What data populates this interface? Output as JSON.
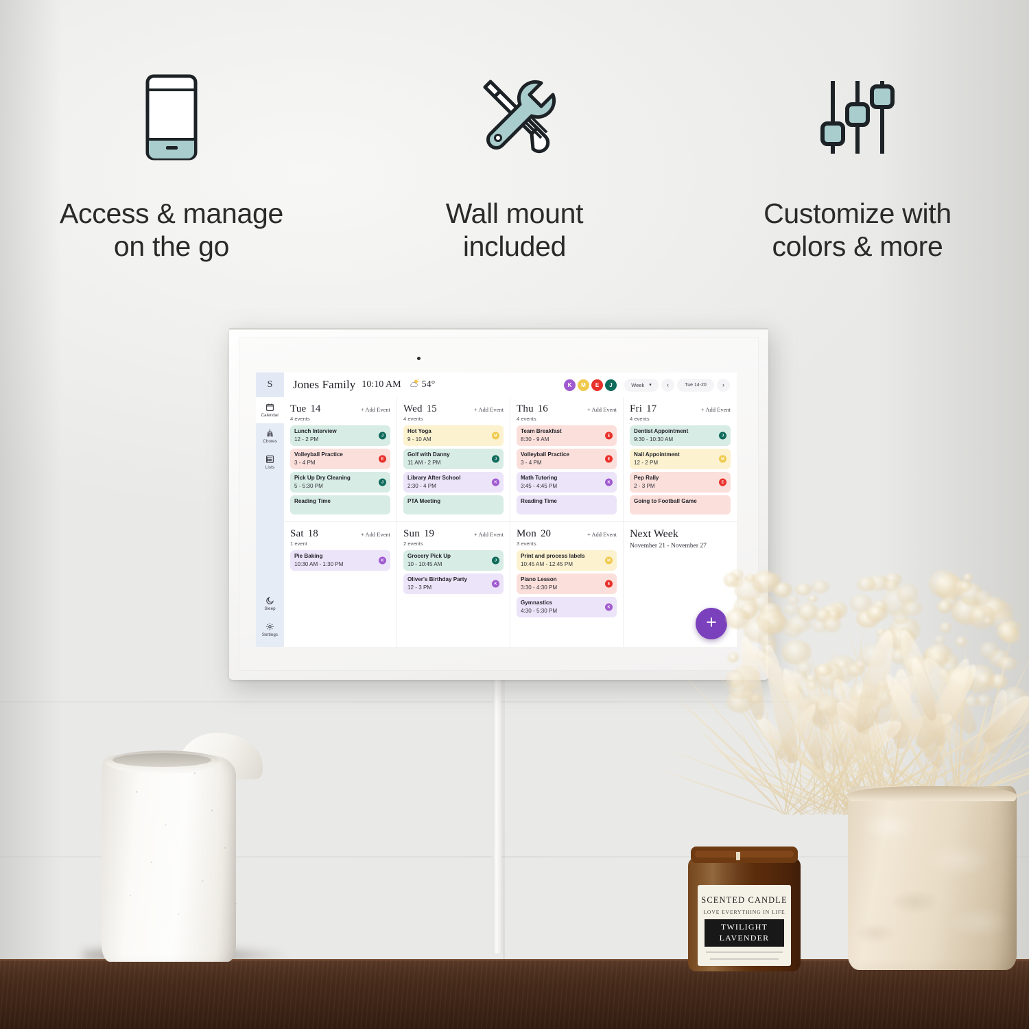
{
  "features": [
    {
      "icon": "smartphone-icon",
      "line1": "Access & manage",
      "line2": "on the go"
    },
    {
      "icon": "wrench-screwdriver-icon",
      "line1": "Wall mount",
      "line2": "included"
    },
    {
      "icon": "sliders-icon",
      "line1": "Customize with",
      "line2": "colors & more"
    }
  ],
  "app": {
    "brand_initial": "S",
    "header": {
      "family_name": "Jones Family",
      "time": "10:10 AM",
      "weather_icon": "sun-behind-cloud-icon",
      "temperature": "54°",
      "avatars": [
        {
          "initial": "K",
          "color": "#a05ad0"
        },
        {
          "initial": "M",
          "color": "#f0ca4d"
        },
        {
          "initial": "E",
          "color": "#e8302a"
        },
        {
          "initial": "J",
          "color": "#0f6b5c"
        }
      ],
      "view_selector": "Week",
      "prev_label": "‹",
      "date_range": "Tue 14-20",
      "next_label": "›"
    },
    "sidebar": {
      "items": [
        {
          "label": "Calendar",
          "icon": "calendar-icon",
          "active": true
        },
        {
          "label": "Chores",
          "icon": "broom-icon",
          "active": false
        },
        {
          "label": "Lists",
          "icon": "list-icon",
          "active": false
        }
      ],
      "bottom_items": [
        {
          "label": "Sleep",
          "icon": "moon-icon"
        },
        {
          "label": "Settings",
          "icon": "gear-icon"
        }
      ]
    },
    "add_event_label": "+ Add Event",
    "fab_label": "+",
    "days": [
      {
        "name": "Tue",
        "num": "14",
        "count": "4 events",
        "events": [
          {
            "title": "Lunch Interview",
            "time": "12 - 2 PM",
            "bg": "#d7ece4",
            "initial": "J",
            "avatar_color": "#0f6b5c"
          },
          {
            "title": "Volleyball Practice",
            "time": "3 - 4 PM",
            "bg": "#fbdfda",
            "initial": "E",
            "avatar_color": "#e8302a"
          },
          {
            "title": "Pick Up Dry Cleaning",
            "time": "5 - 5:30 PM",
            "bg": "#d7ece4",
            "initial": "J",
            "avatar_color": "#0f6b5c"
          },
          {
            "title": "Reading Time",
            "time": "",
            "bg": "#d7ece4",
            "initial": "",
            "avatar_color": "#0f6b5c",
            "clipped": true
          }
        ]
      },
      {
        "name": "Wed",
        "num": "15",
        "count": "4 events",
        "events": [
          {
            "title": "Hot Yoga",
            "time": "9 - 10 AM",
            "bg": "#fcf2cf",
            "initial": "M",
            "avatar_color": "#f0ca4d"
          },
          {
            "title": "Golf with Danny",
            "time": "11 AM - 2 PM",
            "bg": "#d7ece4",
            "initial": "J",
            "avatar_color": "#0f6b5c"
          },
          {
            "title": "Library After School",
            "time": "2:30 - 4 PM",
            "bg": "#ece4f8",
            "initial": "K",
            "avatar_color": "#a05ad0"
          },
          {
            "title": "PTA Meeting",
            "time": "",
            "bg": "#d7ece4",
            "initial": "",
            "avatar_color": "#0f6b5c",
            "clipped": true
          }
        ]
      },
      {
        "name": "Thu",
        "num": "16",
        "count": "4 events",
        "events": [
          {
            "title": "Team Breakfast",
            "time": "8:30 - 9 AM",
            "bg": "#fbdfda",
            "initial": "E",
            "avatar_color": "#e8302a"
          },
          {
            "title": "Volleyball Practice",
            "time": "3 - 4 PM",
            "bg": "#fbdfda",
            "initial": "E",
            "avatar_color": "#e8302a"
          },
          {
            "title": "Math Tutoring",
            "time": "3:45 - 4:45 PM",
            "bg": "#ece4f8",
            "initial": "K",
            "avatar_color": "#a05ad0"
          },
          {
            "title": "Reading Time",
            "time": "",
            "bg": "#ece4f8",
            "initial": "",
            "avatar_color": "#a05ad0",
            "clipped": true
          }
        ]
      },
      {
        "name": "Fri",
        "num": "17",
        "count": "4 events",
        "events": [
          {
            "title": "Dentist Appointment",
            "time": "9:30 - 10:30 AM",
            "bg": "#d7ece4",
            "initial": "J",
            "avatar_color": "#0f6b5c"
          },
          {
            "title": "Nail Appointment",
            "time": "12 - 2 PM",
            "bg": "#fcf2cf",
            "initial": "M",
            "avatar_color": "#f0ca4d"
          },
          {
            "title": "Pep Rally",
            "time": "2 - 3 PM",
            "bg": "#fbdfda",
            "initial": "E",
            "avatar_color": "#e8302a"
          },
          {
            "title": "Going to Football Game",
            "time": "",
            "bg": "#fbdfda",
            "initial": "",
            "avatar_color": "#e8302a",
            "clipped": true
          }
        ]
      },
      {
        "name": "Sat",
        "num": "18",
        "count": "1 event",
        "events": [
          {
            "title": "Pie Baking",
            "time": "10:30 AM - 1:30 PM",
            "bg": "#ece4f8",
            "initial": "K",
            "avatar_color": "#a05ad0"
          }
        ]
      },
      {
        "name": "Sun",
        "num": "19",
        "count": "2 events",
        "events": [
          {
            "title": "Grocery Pick Up",
            "time": "10 - 10:45 AM",
            "bg": "#d7ece4",
            "initial": "J",
            "avatar_color": "#0f6b5c"
          },
          {
            "title": "Oliver's Birthday Party",
            "time": "12 - 3 PM",
            "bg": "#ece4f8",
            "initial": "K",
            "avatar_color": "#a05ad0"
          }
        ]
      },
      {
        "name": "Mon",
        "num": "20",
        "count": "3 events",
        "events": [
          {
            "title": "Print and process labels",
            "time": "10:45 AM - 12:45 PM",
            "bg": "#fcf2cf",
            "initial": "M",
            "avatar_color": "#f0ca4d"
          },
          {
            "title": "Piano Lesson",
            "time": "3:30 - 4:30 PM",
            "bg": "#fbdfda",
            "initial": "E",
            "avatar_color": "#e8302a"
          },
          {
            "title": "Gymnastics",
            "time": "4:30 - 5:30 PM",
            "bg": "#ece4f8",
            "initial": "K",
            "avatar_color": "#a05ad0"
          }
        ]
      }
    ],
    "next_week": {
      "title": "Next Week",
      "range": "November 21 - November 27"
    }
  },
  "scene": {
    "candle": {
      "brand": "SCENTED CANDLE",
      "tagline": "LOVE EVERYTHING IN LIFE",
      "scent_line1": "TWILIGHT",
      "scent_line2": "LAVENDER"
    }
  }
}
